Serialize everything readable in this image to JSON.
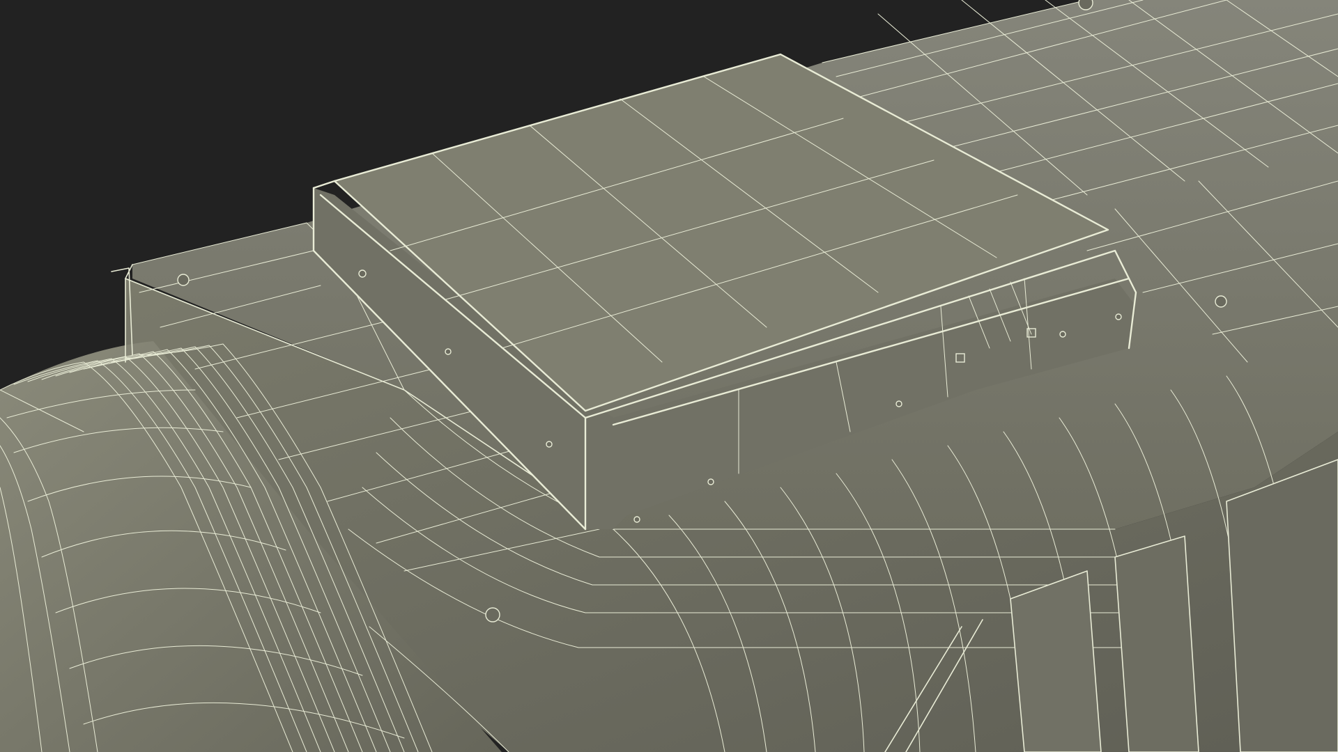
{
  "scene": {
    "subject": "wireframe-3d-model-render",
    "colors": {
      "background": "#222222",
      "surface": "#7b7b6b",
      "surface_light": "#868676",
      "surface_dark": "#65655a",
      "wire": "#e9ecd6"
    }
  }
}
